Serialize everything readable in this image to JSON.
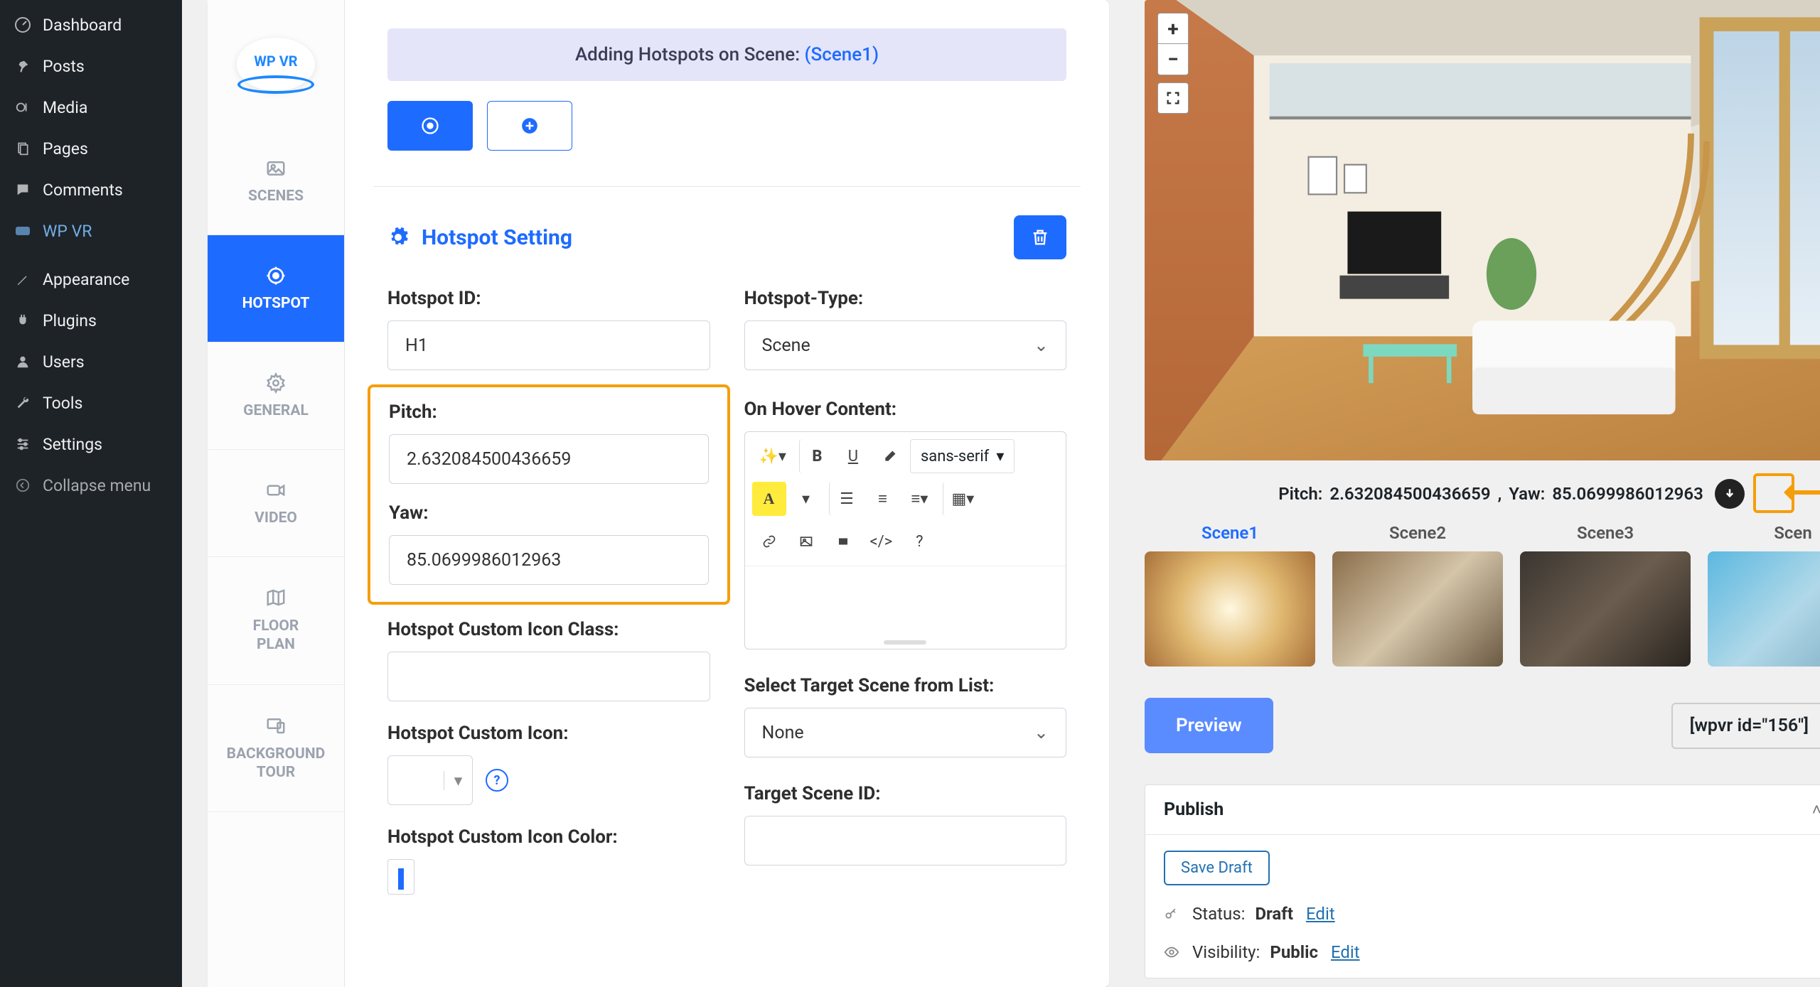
{
  "wp_menu": [
    {
      "label": "Dashboard",
      "icon": "dashboard"
    },
    {
      "label": "Posts",
      "icon": "pin"
    },
    {
      "label": "Media",
      "icon": "media"
    },
    {
      "label": "Pages",
      "icon": "pages"
    },
    {
      "label": "Comments",
      "icon": "comments"
    },
    {
      "label": "WP VR",
      "icon": "wpvr"
    }
  ],
  "wp_menu2": [
    {
      "label": "Appearance",
      "icon": "appearance"
    },
    {
      "label": "Plugins",
      "icon": "plugins"
    },
    {
      "label": "Users",
      "icon": "users"
    },
    {
      "label": "Tools",
      "icon": "tools"
    },
    {
      "label": "Settings",
      "icon": "settings"
    }
  ],
  "collapse_label": "Collapse menu",
  "logo_text": "WP VR",
  "vtabs": {
    "scenes": "SCENES",
    "hotspot": "HOTSPOT",
    "general": "GENERAL",
    "video": "VIDEO",
    "floorplan_l1": "FLOOR",
    "floorplan_l2": "PLAN",
    "bgtour_l1": "BACKGROUND",
    "bgtour_l2": "TOUR"
  },
  "banner": {
    "prefix": "Adding Hotspots on Scene: ",
    "scene": "(Scene1)"
  },
  "setting_title": "Hotspot Setting",
  "fields": {
    "hotspot_id_label": "Hotspot ID:",
    "hotspot_id_value": "H1",
    "hotspot_type_label": "Hotspot-Type:",
    "hotspot_type_value": "Scene",
    "pitch_label": "Pitch:",
    "pitch_value": "2.632084500436659",
    "yaw_label": "Yaw:",
    "yaw_value": "85.0699986012963",
    "on_hover_label": "On Hover Content:",
    "custom_icon_class_label": "Hotspot Custom Icon Class:",
    "target_scene_label": "Select Target Scene from List:",
    "target_scene_value": "None",
    "custom_icon_label": "Hotspot Custom Icon:",
    "target_scene_id_label": "Target Scene ID:",
    "custom_icon_color_label": "Hotspot Custom Icon Color:"
  },
  "rte_font": "sans-serif",
  "pitch_yaw_readout": {
    "pitch_label": "Pitch: ",
    "pitch_val": "2.632084500436659",
    "sep": ", ",
    "yaw_label": "Yaw: ",
    "yaw_val": "85.0699986012963"
  },
  "scenes": [
    {
      "name": "Scene1",
      "active": true
    },
    {
      "name": "Scene2",
      "active": false
    },
    {
      "name": "Scene3",
      "active": false
    },
    {
      "name": "Scen",
      "active": false
    }
  ],
  "preview_btn": "Preview",
  "shortcode": "[wpvr id=\"156\"]",
  "publish": {
    "title": "Publish",
    "save_draft": "Save Draft",
    "status_label": "Status: ",
    "status_value": "Draft",
    "edit": "Edit",
    "visibility_label": "Visibility: ",
    "visibility_value": "Public"
  }
}
